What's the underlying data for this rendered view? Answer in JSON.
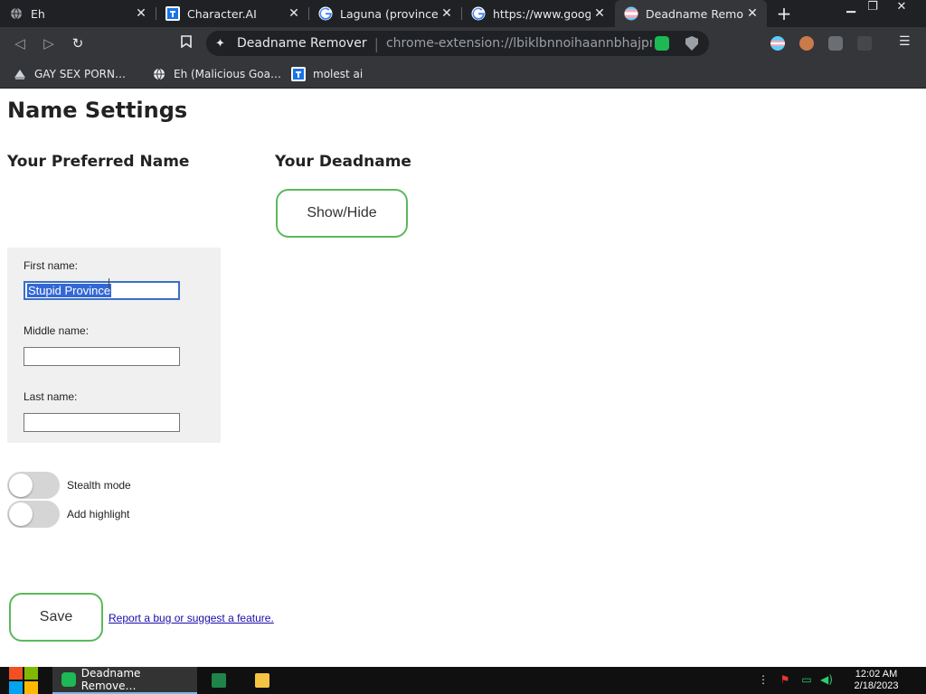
{
  "browser": {
    "tabs": [
      {
        "title": "Eh",
        "icon": "globe-icon"
      },
      {
        "title": "Character.AI",
        "icon": "character-ai-icon"
      },
      {
        "title": "Laguna (province) -",
        "icon": "google-icon"
      },
      {
        "title": "https://www.google.",
        "icon": "google-icon"
      },
      {
        "title": "Deadname Remover",
        "icon": "trans-flag-icon",
        "active": true
      }
    ],
    "new_tab_symbol": "+",
    "address_bar": {
      "page_name": "Deadname Remover",
      "url": "chrome-extension://lbiklbnnoihaannbhajpmp…"
    },
    "bookmarks": [
      {
        "label": "GAY SEX PORN…",
        "icon": "bookmark-site-icon"
      },
      {
        "label": "Eh (Malicious Goa…",
        "icon": "globe-icon"
      },
      {
        "label": "molest ai",
        "icon": "character-ai-icon"
      }
    ]
  },
  "page": {
    "title": "Name Settings",
    "preferred_heading": "Your Preferred Name",
    "deadname_heading": "Your Deadname",
    "show_hide_label": "Show/Hide",
    "fields": {
      "first_label": "First name:",
      "first_value": "Stupid Province",
      "middle_label": "Middle name:",
      "middle_value": "",
      "last_label": "Last name:",
      "last_value": ""
    },
    "toggles": [
      {
        "label": "Stealth mode",
        "on": false
      },
      {
        "label": "Add highlight",
        "on": false
      }
    ],
    "save_label": "Save",
    "report_link": "Report a bug or suggest a feature."
  },
  "taskbar": {
    "active_app": "Deadname Remove…",
    "time": "12:02 AM",
    "date": "2/18/2023"
  },
  "colors": {
    "accent_green": "#5cb85c",
    "chrome_dark": "#202124",
    "chrome_toolbar": "#35363a",
    "selection": "#3367d6",
    "link": "#1a0dab"
  }
}
